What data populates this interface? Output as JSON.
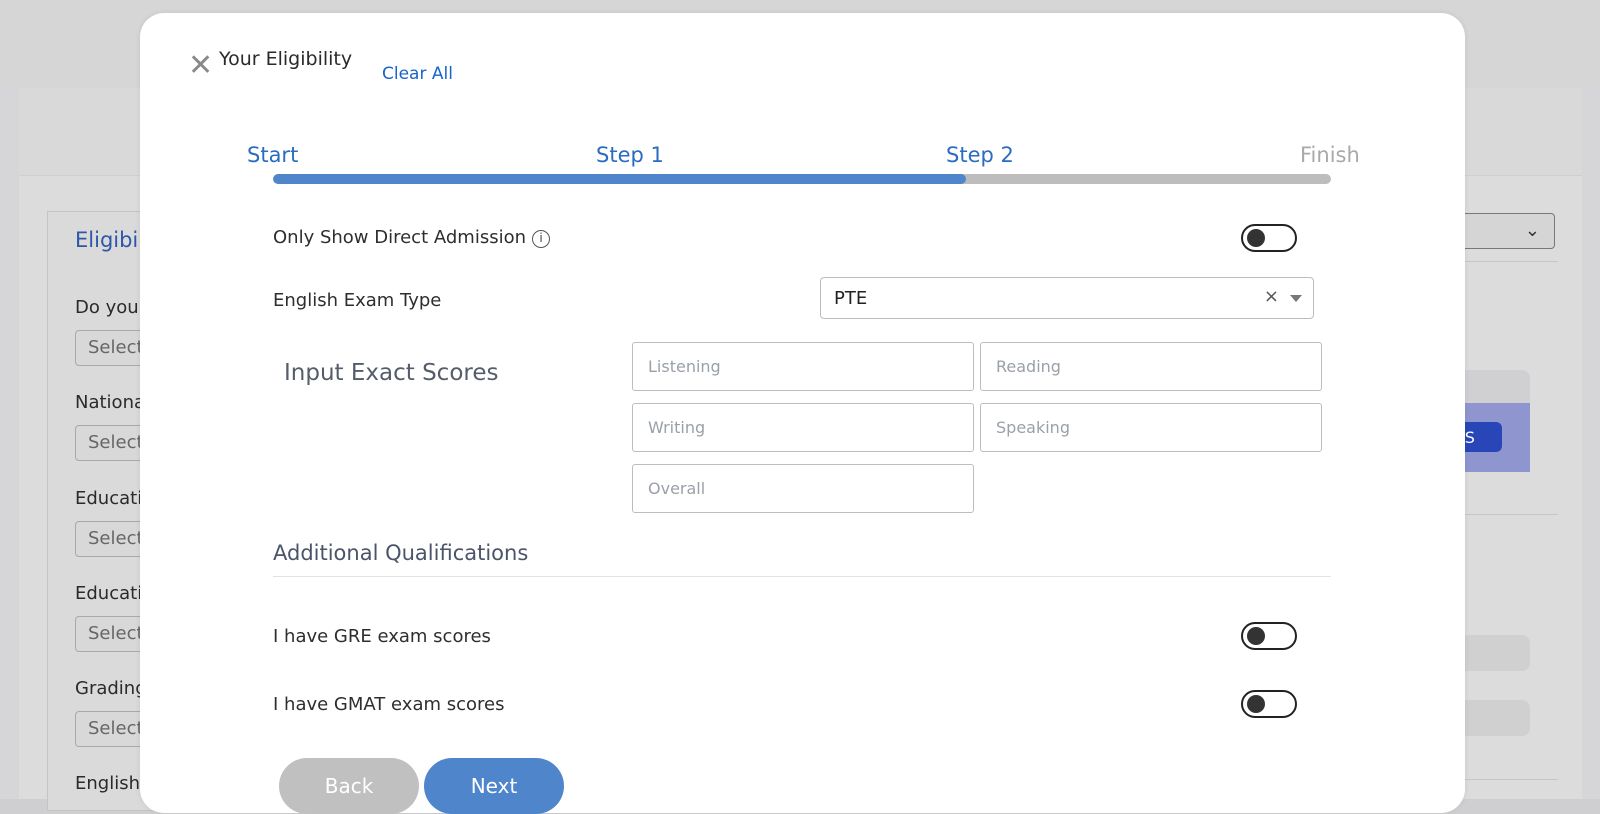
{
  "background": {
    "eligibility_title": "Eligibility",
    "labels": [
      "Do you",
      "Nationa",
      "Educati",
      "Educati",
      "Grading",
      "English"
    ],
    "select_placeholder": "Select",
    "badge_text": "AMS"
  },
  "modal": {
    "title": "Your Eligibility",
    "clear_all": "Clear All",
    "steps": [
      {
        "label": "Start",
        "active": true
      },
      {
        "label": "Step 1",
        "active": true
      },
      {
        "label": "Step 2",
        "active": true
      },
      {
        "label": "Finish",
        "active": false
      }
    ],
    "progress_fraction": 0.655,
    "direct_admission_label": "Only Show Direct Admission",
    "direct_admission_info": "i",
    "exam_type_label": "English Exam Type",
    "exam_type_value": "PTE",
    "exam_type_clear": "×",
    "scores_title": "Input Exact Scores",
    "scores": {
      "listening_placeholder": "Listening",
      "reading_placeholder": "Reading",
      "writing_placeholder": "Writing",
      "speaking_placeholder": "Speaking",
      "overall_placeholder": "Overall"
    },
    "additional_title": "Additional Qualifications",
    "gre_label": "I have GRE exam scores",
    "gmat_label": "I have GMAT exam scores",
    "back_label": "Back",
    "next_label": "Next"
  },
  "colors": {
    "accent": "#4f86cb",
    "link": "#1a63c7",
    "inactive_step": "#a9a9a9"
  },
  "icons": {
    "close": "close-icon",
    "info": "info-icon",
    "dropdown": "chevron-down-icon"
  }
}
